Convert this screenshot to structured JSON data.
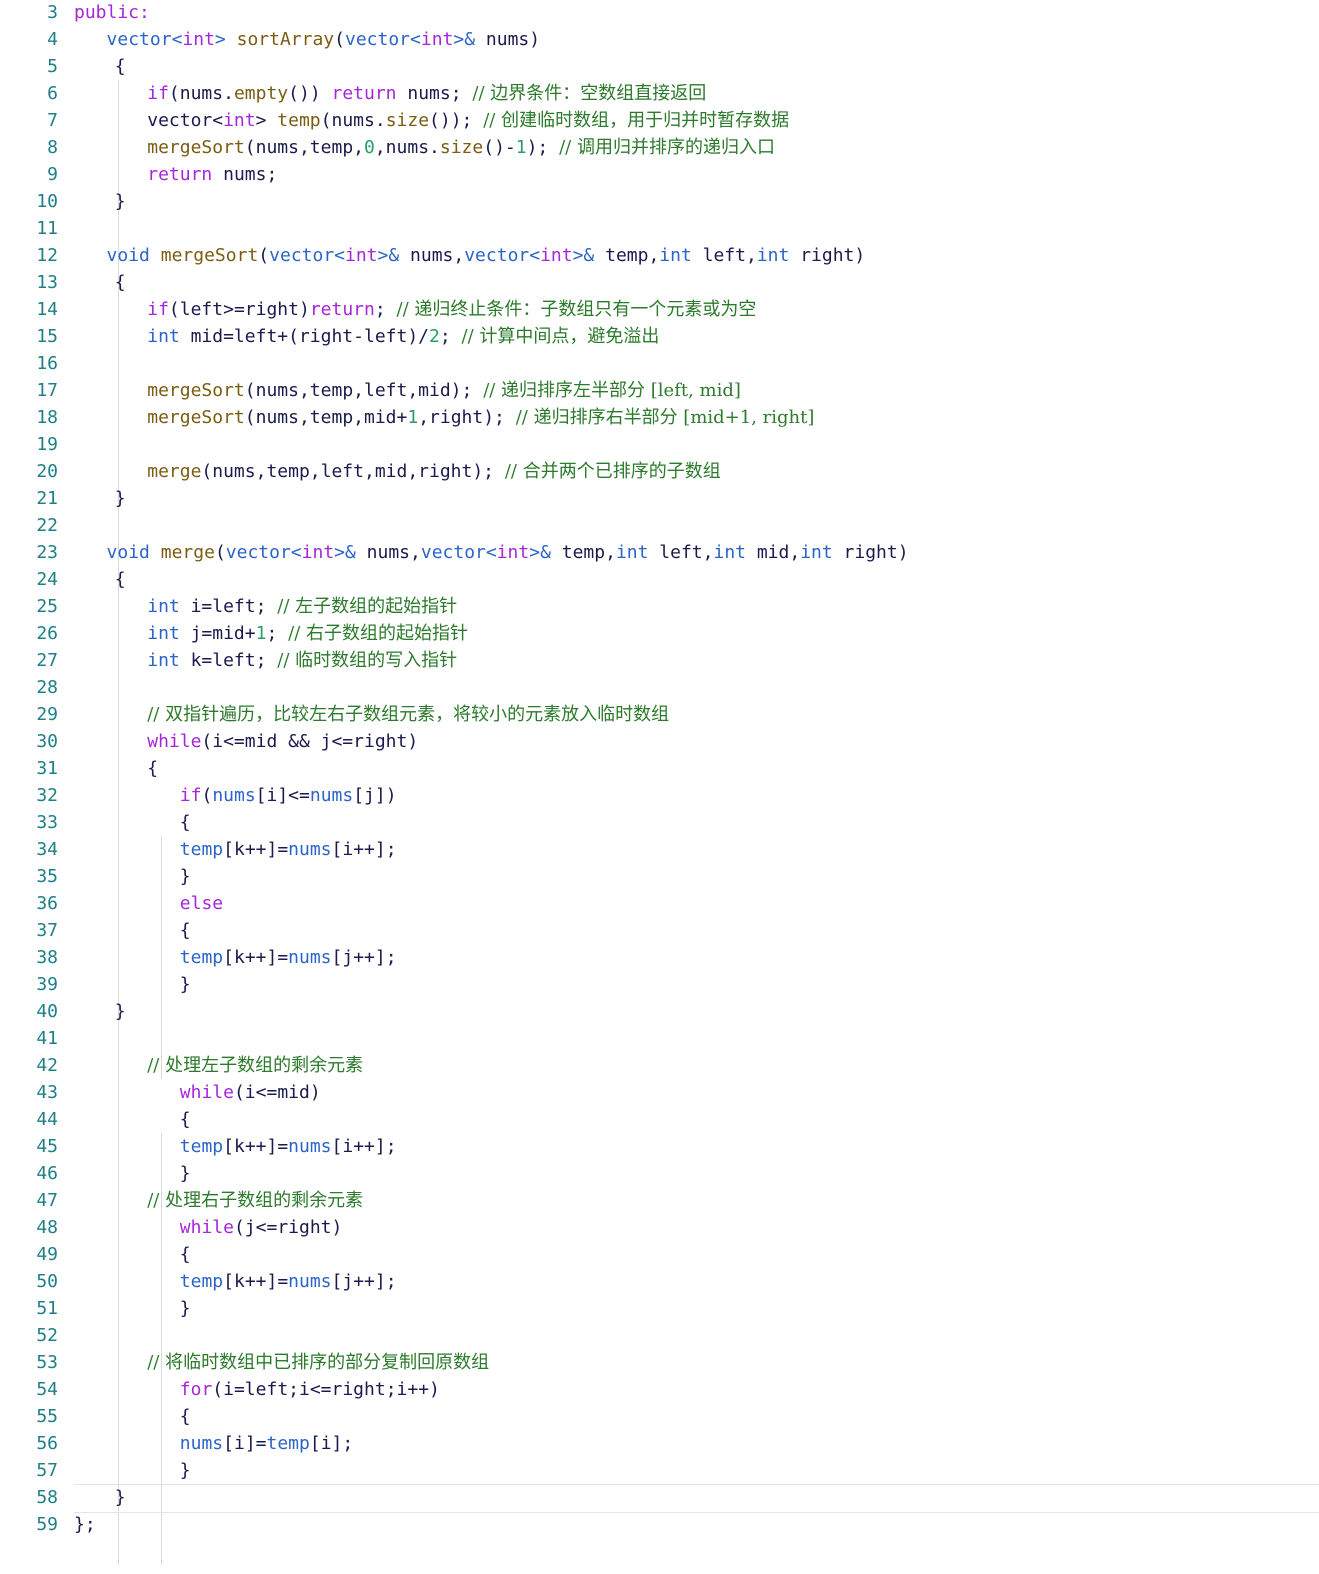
{
  "editor": {
    "colors": {
      "background": "#ffffff",
      "line_number": "#1e7f86",
      "keyword": "#a626d9",
      "type": "#2b64c8",
      "function": "#7a5c12",
      "number": "#2a9d68",
      "comment": "#2c7a2c",
      "plain": "#1a1a4d",
      "indent_guide": "#d9d9d9"
    },
    "active_line": 58,
    "lines": [
      {
        "n": "3",
        "indent": 0,
        "tokens": [
          {
            "t": "public:",
            "c": "keyword"
          }
        ]
      },
      {
        "n": "4",
        "indent": 4,
        "tokens": [
          {
            "t": "vector<",
            "c": "type"
          },
          {
            "t": "int",
            "c": "keyword"
          },
          {
            "t": "> ",
            "c": "type"
          },
          {
            "t": "sortArray",
            "c": "func"
          },
          {
            "t": "(",
            "c": "plain"
          },
          {
            "t": "vector<",
            "c": "type"
          },
          {
            "t": "int",
            "c": "keyword"
          },
          {
            "t": ">& ",
            "c": "type"
          },
          {
            "t": "nums)",
            "c": "plain"
          }
        ]
      },
      {
        "n": "5",
        "indent": 5,
        "tokens": [
          {
            "t": "{",
            "c": "plain"
          }
        ]
      },
      {
        "n": "6",
        "indent": 9,
        "tokens": [
          {
            "t": "if",
            "c": "keyword"
          },
          {
            "t": "(nums.",
            "c": "plain"
          },
          {
            "t": "empty",
            "c": "func"
          },
          {
            "t": "()) ",
            "c": "plain"
          },
          {
            "t": "return",
            "c": "keyword"
          },
          {
            "t": " nums; ",
            "c": "plain"
          },
          {
            "t": "// 边界条件：空数组直接返回",
            "c": "comment"
          }
        ]
      },
      {
        "n": "7",
        "indent": 9,
        "tokens": [
          {
            "t": "vector<",
            "c": "plain"
          },
          {
            "t": "int",
            "c": "keyword"
          },
          {
            "t": "> ",
            "c": "plain"
          },
          {
            "t": "temp",
            "c": "func"
          },
          {
            "t": "(nums.",
            "c": "plain"
          },
          {
            "t": "size",
            "c": "func"
          },
          {
            "t": "()); ",
            "c": "plain"
          },
          {
            "t": "// 创建临时数组，用于归并时暂存数据",
            "c": "comment"
          }
        ]
      },
      {
        "n": "8",
        "indent": 9,
        "tokens": [
          {
            "t": "mergeSort",
            "c": "func"
          },
          {
            "t": "(nums,temp,",
            "c": "plain"
          },
          {
            "t": "0",
            "c": "num"
          },
          {
            "t": ",nums.",
            "c": "plain"
          },
          {
            "t": "size",
            "c": "func"
          },
          {
            "t": "()-",
            "c": "plain"
          },
          {
            "t": "1",
            "c": "num"
          },
          {
            "t": "); ",
            "c": "plain"
          },
          {
            "t": "// 调用归并排序的递归入口",
            "c": "comment"
          }
        ]
      },
      {
        "n": "9",
        "indent": 9,
        "tokens": [
          {
            "t": "return",
            "c": "keyword"
          },
          {
            "t": " nums;",
            "c": "plain"
          }
        ]
      },
      {
        "n": "10",
        "indent": 5,
        "tokens": [
          {
            "t": "}",
            "c": "plain"
          }
        ]
      },
      {
        "n": "11",
        "indent": 0,
        "tokens": []
      },
      {
        "n": "12",
        "indent": 4,
        "tokens": [
          {
            "t": "void",
            "c": "type"
          },
          {
            "t": " ",
            "c": "plain"
          },
          {
            "t": "mergeSort",
            "c": "func"
          },
          {
            "t": "(",
            "c": "plain"
          },
          {
            "t": "vector<",
            "c": "type"
          },
          {
            "t": "int",
            "c": "keyword"
          },
          {
            "t": ">& ",
            "c": "type"
          },
          {
            "t": "nums,",
            "c": "plain"
          },
          {
            "t": "vector<",
            "c": "type"
          },
          {
            "t": "int",
            "c": "keyword"
          },
          {
            "t": ">& ",
            "c": "type"
          },
          {
            "t": "temp,",
            "c": "plain"
          },
          {
            "t": "int",
            "c": "type"
          },
          {
            "t": " left,",
            "c": "plain"
          },
          {
            "t": "int",
            "c": "type"
          },
          {
            "t": " right)",
            "c": "plain"
          }
        ]
      },
      {
        "n": "13",
        "indent": 5,
        "tokens": [
          {
            "t": "{",
            "c": "plain"
          }
        ]
      },
      {
        "n": "14",
        "indent": 9,
        "tokens": [
          {
            "t": "if",
            "c": "keyword"
          },
          {
            "t": "(left>=right)",
            "c": "plain"
          },
          {
            "t": "return",
            "c": "keyword"
          },
          {
            "t": "; ",
            "c": "plain"
          },
          {
            "t": "// 递归终止条件：子数组只有一个元素或为空",
            "c": "comment"
          }
        ]
      },
      {
        "n": "15",
        "indent": 9,
        "tokens": [
          {
            "t": "int",
            "c": "type"
          },
          {
            "t": " mid=left+(right-left)/",
            "c": "plain"
          },
          {
            "t": "2",
            "c": "num"
          },
          {
            "t": "; ",
            "c": "plain"
          },
          {
            "t": "// 计算中间点，避免溢出",
            "c": "comment"
          }
        ]
      },
      {
        "n": "16",
        "indent": 0,
        "tokens": []
      },
      {
        "n": "17",
        "indent": 9,
        "tokens": [
          {
            "t": "mergeSort",
            "c": "func"
          },
          {
            "t": "(nums,temp,left,mid); ",
            "c": "plain"
          },
          {
            "t": "// 递归排序左半部分 [left, mid]",
            "c": "comment"
          }
        ]
      },
      {
        "n": "18",
        "indent": 9,
        "tokens": [
          {
            "t": "mergeSort",
            "c": "func"
          },
          {
            "t": "(nums,temp,mid+",
            "c": "plain"
          },
          {
            "t": "1",
            "c": "num"
          },
          {
            "t": ",right); ",
            "c": "plain"
          },
          {
            "t": "// 递归排序右半部分 [mid+1, right]",
            "c": "comment"
          }
        ]
      },
      {
        "n": "19",
        "indent": 0,
        "tokens": []
      },
      {
        "n": "20",
        "indent": 9,
        "tokens": [
          {
            "t": "merge",
            "c": "func"
          },
          {
            "t": "(nums,temp,left,mid,right); ",
            "c": "plain"
          },
          {
            "t": "// 合并两个已排序的子数组",
            "c": "comment"
          }
        ]
      },
      {
        "n": "21",
        "indent": 5,
        "tokens": [
          {
            "t": "}",
            "c": "plain"
          }
        ]
      },
      {
        "n": "22",
        "indent": 0,
        "tokens": []
      },
      {
        "n": "23",
        "indent": 4,
        "tokens": [
          {
            "t": "void",
            "c": "type"
          },
          {
            "t": " ",
            "c": "plain"
          },
          {
            "t": "merge",
            "c": "func"
          },
          {
            "t": "(",
            "c": "plain"
          },
          {
            "t": "vector<",
            "c": "type"
          },
          {
            "t": "int",
            "c": "keyword"
          },
          {
            "t": ">& ",
            "c": "type"
          },
          {
            "t": "nums,",
            "c": "plain"
          },
          {
            "t": "vector<",
            "c": "type"
          },
          {
            "t": "int",
            "c": "keyword"
          },
          {
            "t": ">& ",
            "c": "type"
          },
          {
            "t": "temp,",
            "c": "plain"
          },
          {
            "t": "int",
            "c": "type"
          },
          {
            "t": " left,",
            "c": "plain"
          },
          {
            "t": "int",
            "c": "type"
          },
          {
            "t": " mid,",
            "c": "plain"
          },
          {
            "t": "int",
            "c": "type"
          },
          {
            "t": " right)",
            "c": "plain"
          }
        ]
      },
      {
        "n": "24",
        "indent": 5,
        "tokens": [
          {
            "t": "{",
            "c": "plain"
          }
        ]
      },
      {
        "n": "25",
        "indent": 9,
        "tokens": [
          {
            "t": "int",
            "c": "type"
          },
          {
            "t": " i=left; ",
            "c": "plain"
          },
          {
            "t": "// 左子数组的起始指针",
            "c": "comment"
          }
        ]
      },
      {
        "n": "26",
        "indent": 9,
        "tokens": [
          {
            "t": "int",
            "c": "type"
          },
          {
            "t": " j=mid+",
            "c": "plain"
          },
          {
            "t": "1",
            "c": "num"
          },
          {
            "t": "; ",
            "c": "plain"
          },
          {
            "t": "// 右子数组的起始指针",
            "c": "comment"
          }
        ]
      },
      {
        "n": "27",
        "indent": 9,
        "tokens": [
          {
            "t": "int",
            "c": "type"
          },
          {
            "t": " k=left; ",
            "c": "plain"
          },
          {
            "t": "// 临时数组的写入指针",
            "c": "comment"
          }
        ]
      },
      {
        "n": "28",
        "indent": 0,
        "tokens": []
      },
      {
        "n": "29",
        "indent": 9,
        "tokens": [
          {
            "t": "// 双指针遍历，比较左右子数组元素，将较小的元素放入临时数组",
            "c": "comment"
          }
        ]
      },
      {
        "n": "30",
        "indent": 9,
        "tokens": [
          {
            "t": "while",
            "c": "keyword"
          },
          {
            "t": "(i<=mid && j<=right)",
            "c": "plain"
          }
        ]
      },
      {
        "n": "31",
        "indent": 9,
        "tokens": [
          {
            "t": "{",
            "c": "plain"
          }
        ]
      },
      {
        "n": "32",
        "indent": 13,
        "tokens": [
          {
            "t": "if",
            "c": "keyword"
          },
          {
            "t": "(",
            "c": "plain"
          },
          {
            "t": "nums",
            "c": "type"
          },
          {
            "t": "[i]<=",
            "c": "plain"
          },
          {
            "t": "nums",
            "c": "type"
          },
          {
            "t": "[j])",
            "c": "plain"
          }
        ]
      },
      {
        "n": "33",
        "indent": 13,
        "tokens": [
          {
            "t": "{",
            "c": "plain"
          }
        ]
      },
      {
        "n": "34",
        "indent": 13,
        "tokens": [
          {
            "t": "temp",
            "c": "type"
          },
          {
            "t": "[k++]=",
            "c": "plain"
          },
          {
            "t": "nums",
            "c": "type"
          },
          {
            "t": "[i++];",
            "c": "plain"
          }
        ]
      },
      {
        "n": "35",
        "indent": 13,
        "tokens": [
          {
            "t": "}",
            "c": "plain"
          }
        ]
      },
      {
        "n": "36",
        "indent": 13,
        "tokens": [
          {
            "t": "else",
            "c": "keyword"
          }
        ]
      },
      {
        "n": "37",
        "indent": 13,
        "tokens": [
          {
            "t": "{",
            "c": "plain"
          }
        ]
      },
      {
        "n": "38",
        "indent": 13,
        "tokens": [
          {
            "t": "temp",
            "c": "type"
          },
          {
            "t": "[k++]=",
            "c": "plain"
          },
          {
            "t": "nums",
            "c": "type"
          },
          {
            "t": "[j++];",
            "c": "plain"
          }
        ]
      },
      {
        "n": "39",
        "indent": 13,
        "tokens": [
          {
            "t": "}",
            "c": "plain"
          }
        ]
      },
      {
        "n": "40",
        "indent": 5,
        "tokens": [
          {
            "t": "}",
            "c": "plain"
          }
        ]
      },
      {
        "n": "41",
        "indent": 0,
        "tokens": []
      },
      {
        "n": "42",
        "indent": 9,
        "tokens": [
          {
            "t": "// 处理左子数组的剩余元素",
            "c": "comment"
          }
        ]
      },
      {
        "n": "43",
        "indent": 13,
        "tokens": [
          {
            "t": "while",
            "c": "keyword"
          },
          {
            "t": "(i<=mid)",
            "c": "plain"
          }
        ]
      },
      {
        "n": "44",
        "indent": 13,
        "tokens": [
          {
            "t": "{",
            "c": "plain"
          }
        ]
      },
      {
        "n": "45",
        "indent": 13,
        "tokens": [
          {
            "t": "temp",
            "c": "type"
          },
          {
            "t": "[k++]=",
            "c": "plain"
          },
          {
            "t": "nums",
            "c": "type"
          },
          {
            "t": "[i++];",
            "c": "plain"
          }
        ]
      },
      {
        "n": "46",
        "indent": 13,
        "tokens": [
          {
            "t": "}",
            "c": "plain"
          }
        ]
      },
      {
        "n": "47",
        "indent": 9,
        "tokens": [
          {
            "t": "// 处理右子数组的剩余元素",
            "c": "comment"
          }
        ]
      },
      {
        "n": "48",
        "indent": 13,
        "tokens": [
          {
            "t": "while",
            "c": "keyword"
          },
          {
            "t": "(j<=right)",
            "c": "plain"
          }
        ]
      },
      {
        "n": "49",
        "indent": 13,
        "tokens": [
          {
            "t": "{",
            "c": "plain"
          }
        ]
      },
      {
        "n": "50",
        "indent": 13,
        "tokens": [
          {
            "t": "temp",
            "c": "type"
          },
          {
            "t": "[k++]=",
            "c": "plain"
          },
          {
            "t": "nums",
            "c": "type"
          },
          {
            "t": "[j++];",
            "c": "plain"
          }
        ]
      },
      {
        "n": "51",
        "indent": 13,
        "tokens": [
          {
            "t": "}",
            "c": "plain"
          }
        ]
      },
      {
        "n": "52",
        "indent": 0,
        "tokens": []
      },
      {
        "n": "53",
        "indent": 9,
        "tokens": [
          {
            "t": "// 将临时数组中已排序的部分复制回原数组",
            "c": "comment"
          }
        ]
      },
      {
        "n": "54",
        "indent": 13,
        "tokens": [
          {
            "t": "for",
            "c": "keyword"
          },
          {
            "t": "(i=left;i<=right;i++)",
            "c": "plain"
          }
        ]
      },
      {
        "n": "55",
        "indent": 13,
        "tokens": [
          {
            "t": "{",
            "c": "plain"
          }
        ]
      },
      {
        "n": "56",
        "indent": 13,
        "tokens": [
          {
            "t": "nums",
            "c": "type"
          },
          {
            "t": "[i]=",
            "c": "plain"
          },
          {
            "t": "temp",
            "c": "type"
          },
          {
            "t": "[i];",
            "c": "plain"
          }
        ]
      },
      {
        "n": "57",
        "indent": 13,
        "tokens": [
          {
            "t": "}",
            "c": "plain"
          }
        ]
      },
      {
        "n": "58",
        "indent": 5,
        "tokens": [
          {
            "t": "}",
            "c": "plain"
          }
        ]
      },
      {
        "n": "59",
        "indent": 0,
        "tokens": [
          {
            "t": "};",
            "c": "plain"
          }
        ]
      }
    ]
  }
}
